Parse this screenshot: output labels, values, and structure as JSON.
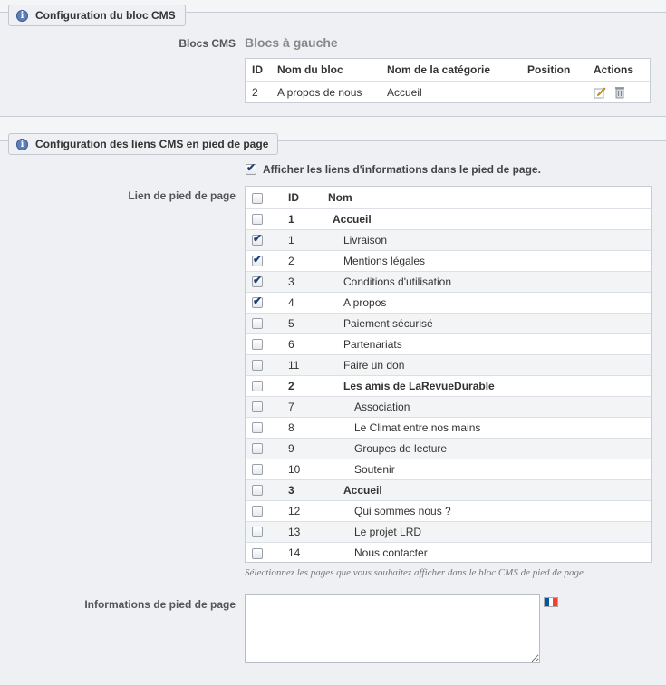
{
  "section1": {
    "title": "Configuration du bloc CMS",
    "blocs_label": "Blocs CMS",
    "blocs_value": "Blocs à gauche",
    "table": {
      "headers": [
        "ID",
        "Nom du bloc",
        "Nom de la catégorie",
        "Position",
        "Actions"
      ],
      "rows": [
        {
          "id": "2",
          "name": "A propos de nous",
          "category": "Accueil",
          "position": ""
        }
      ],
      "actions": [
        "edit-icon",
        "delete-icon"
      ]
    }
  },
  "section2": {
    "title": "Configuration des liens CMS en pied de page",
    "show_links_checked": true,
    "show_links_label": "Afficher les liens d'informations dans le pied de page.",
    "footer_link_label": "Lien de pied de page",
    "table": {
      "headers": [
        "ID",
        "Nom"
      ],
      "rows": [
        {
          "id": "1",
          "name": "Accueil",
          "checked": false,
          "level": 0,
          "bold": true
        },
        {
          "id": "1",
          "name": "Livraison",
          "checked": true,
          "level": 1,
          "bold": false
        },
        {
          "id": "2",
          "name": "Mentions légales",
          "checked": true,
          "level": 1,
          "bold": false
        },
        {
          "id": "3",
          "name": "Conditions d'utilisation",
          "checked": true,
          "level": 1,
          "bold": false
        },
        {
          "id": "4",
          "name": "A propos",
          "checked": true,
          "level": 1,
          "bold": false
        },
        {
          "id": "5",
          "name": "Paiement sécurisé",
          "checked": false,
          "level": 1,
          "bold": false
        },
        {
          "id": "6",
          "name": "Partenariats",
          "checked": false,
          "level": 1,
          "bold": false
        },
        {
          "id": "11",
          "name": "Faire un don",
          "checked": false,
          "level": 1,
          "bold": false
        },
        {
          "id": "2",
          "name": "Les amis de LaRevueDurable",
          "checked": false,
          "level": 1,
          "bold": true
        },
        {
          "id": "7",
          "name": "Association",
          "checked": false,
          "level": 2,
          "bold": false
        },
        {
          "id": "8",
          "name": "Le Climat entre nos mains",
          "checked": false,
          "level": 2,
          "bold": false
        },
        {
          "id": "9",
          "name": "Groupes de lecture",
          "checked": false,
          "level": 2,
          "bold": false
        },
        {
          "id": "10",
          "name": "Soutenir",
          "checked": false,
          "level": 2,
          "bold": false
        },
        {
          "id": "3",
          "name": "Accueil",
          "checked": false,
          "level": 1,
          "bold": true
        },
        {
          "id": "12",
          "name": "Qui sommes nous ?",
          "checked": false,
          "level": 2,
          "bold": false
        },
        {
          "id": "13",
          "name": "Le projet LRD",
          "checked": false,
          "level": 2,
          "bold": false
        },
        {
          "id": "14",
          "name": "Nous contacter",
          "checked": false,
          "level": 2,
          "bold": false
        }
      ]
    },
    "hint": "Sélectionnez les pages que vous souhaitez afficher dans le bloc CMS de pied de page",
    "footer_info_label": "Informations de pied de page",
    "footer_info_value": "",
    "flag_colors": [
      "#0055a4",
      "#ffffff",
      "#ef4135"
    ]
  }
}
